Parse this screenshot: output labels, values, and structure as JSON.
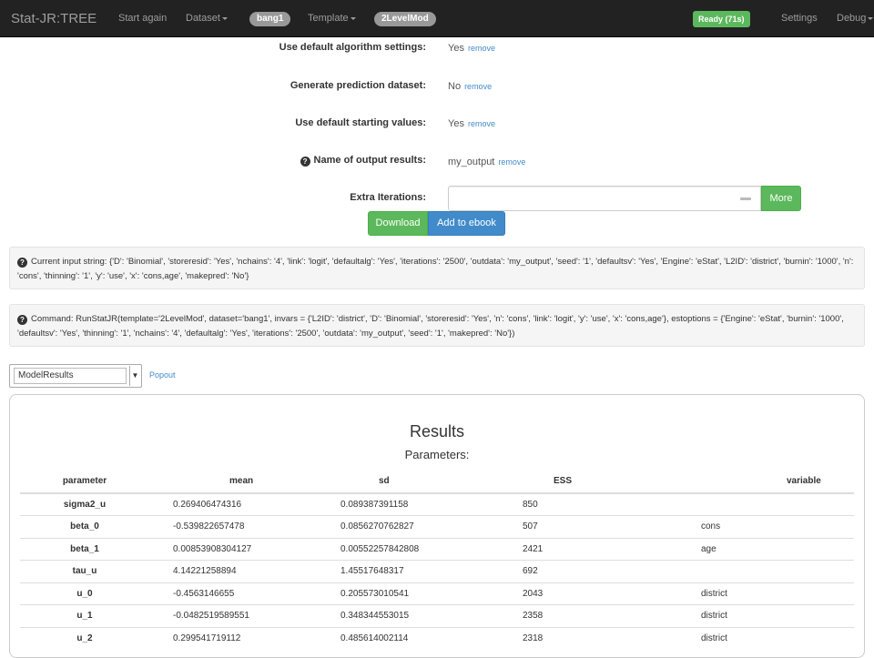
{
  "navbar": {
    "brand": "Stat-JR:TREE",
    "start_again": "Start again",
    "dataset": "Dataset",
    "dataset_badge": "bang1",
    "template": "Template",
    "template_badge": "2LevelMod",
    "ready": "Ready (71s)",
    "settings": "Settings",
    "debug": "Debug"
  },
  "form": {
    "rows": [
      {
        "label": "Use default algorithm settings:",
        "value": "Yes",
        "link": "remove"
      },
      {
        "label": "Generate prediction dataset:",
        "value": "No",
        "link": "remove"
      },
      {
        "label": "Use default starting values:",
        "value": "Yes",
        "link": "remove"
      },
      {
        "label": "Name of output results:",
        "value": "my_output",
        "link": "remove"
      }
    ],
    "extra_iterations_label": "Extra Iterations:",
    "extra_iterations_value": "",
    "more_button": "More",
    "download_button": "Download",
    "ebook_button": "Add to ebook"
  },
  "info": {
    "input_string": "Current input string: {'D': 'Binomial', 'storeresid': 'Yes', 'nchains': '4', 'link': 'logit', 'defaultalg': 'Yes', 'iterations': '2500', 'outdata': 'my_output', 'seed': '1', 'defaultsv': 'Yes', 'Engine': 'eStat', 'L2ID': 'district', 'burnin': '1000', 'n': 'cons', 'thinning': '1', 'y': 'use', 'x': 'cons,age', 'makepred': 'No'}",
    "command": "Command: RunStatJR(template='2LevelMod', dataset='bang1', invars = {'L2ID': 'district', 'D': 'Binomial', 'storeresid': 'Yes', 'n': 'cons', 'link': 'logit', 'y': 'use', 'x': 'cons,age'}, estoptions = {'Engine': 'eStat', 'burnin': '1000', 'defaultsv': 'Yes', 'thinning': '1', 'nchains': '4', 'defaultalg': 'Yes', 'iterations': '2500', 'outdata': 'my_output', 'seed': '1', 'makepred': 'No'})"
  },
  "output_select": {
    "selected": "ModelResults",
    "popout": "Popout"
  },
  "results": {
    "title": "Results",
    "subtitle": "Parameters:",
    "headers": [
      "parameter",
      "mean",
      "sd",
      "ESS",
      "variable"
    ],
    "rows": [
      [
        "sigma2_u",
        "0.269406474316",
        "0.089387391158",
        "850",
        ""
      ],
      [
        "beta_0",
        "-0.539822657478",
        "0.0856270762827",
        "507",
        "cons"
      ],
      [
        "beta_1",
        "0.00853908304127",
        "0.00552257842808",
        "2421",
        "age"
      ],
      [
        "tau_u",
        "4.14221258894",
        "1.45517648317",
        "692",
        ""
      ],
      [
        "u_0",
        "-0.4563146655",
        "0.205573010541",
        "2043",
        "district"
      ],
      [
        "u_1",
        "-0.0482519589551",
        "0.348344553015",
        "2358",
        "district"
      ],
      [
        "u_2",
        "0.299541719112",
        "0.485614002114",
        "2318",
        "district"
      ]
    ]
  }
}
